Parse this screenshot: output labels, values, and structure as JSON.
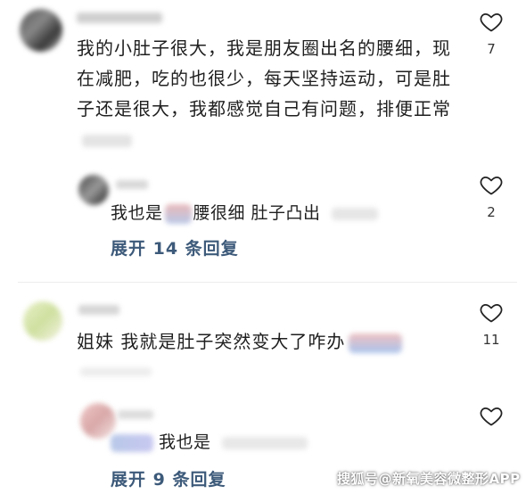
{
  "comments": [
    {
      "text": "我的小肚子很大，我是朋友圈出名的腰细，现在减肥，吃的也很少，每天坚持运动，可是肚子还是很大，我都感觉自己有问题，排便正常",
      "likes": "7",
      "reply": {
        "text_prefix": "我也是",
        "text_suffix": "腰很细 肚子凸出",
        "likes": "2"
      },
      "expand_label": "展开 14 条回复"
    },
    {
      "text": "姐妹 我就是肚子突然变大了咋办",
      "likes": "11",
      "reply": {
        "text_prefix": "我也是",
        "likes": ""
      },
      "expand_label": "展开 9 条回复"
    }
  ],
  "watermark": "搜狐号@新氧美容微整形APP",
  "icons": {
    "like": "heart-outline-icon"
  },
  "colors": {
    "expand_link": "#3d5a7a",
    "text": "#1f1f1f"
  }
}
